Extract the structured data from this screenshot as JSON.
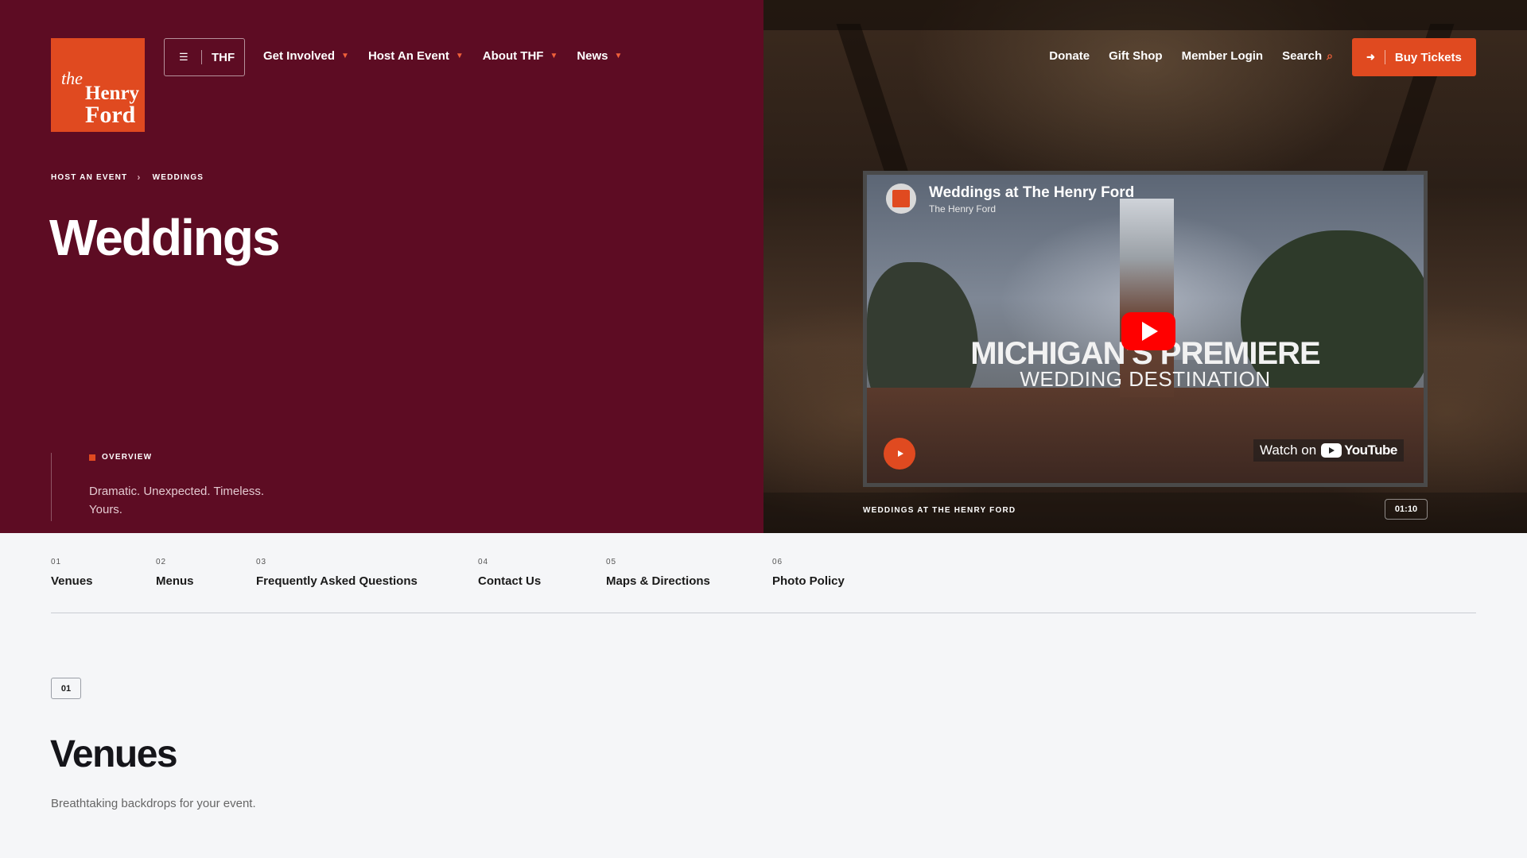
{
  "brand": {
    "logo_the": "the",
    "logo_henry": "Henry",
    "logo_ford": "Ford",
    "accent": "#e04a20",
    "hero_bg": "#5d0c23"
  },
  "header": {
    "menu_label": "THF",
    "nav": [
      {
        "label": "Get Involved"
      },
      {
        "label": "Host An Event"
      },
      {
        "label": "About THF"
      },
      {
        "label": "News"
      }
    ],
    "utility": {
      "donate": "Donate",
      "gift_shop": "Gift Shop",
      "member_login": "Member Login",
      "search": "Search"
    },
    "tickets_label": "Buy Tickets"
  },
  "breadcrumb": {
    "parent": "HOST AN EVENT",
    "current": "WEDDINGS"
  },
  "page_title": "Weddings",
  "overview": {
    "label": "OVERVIEW",
    "description": "Dramatic. Unexpected. Timeless. Yours."
  },
  "video": {
    "title": "Weddings at The Henry Ford",
    "channel": "The Henry Ford",
    "headline_1": "MICHIGAN'S PREMIERE",
    "headline_2": "WEDDING DESTINATION",
    "watch_on": "Watch on",
    "youtube": "YouTube",
    "caption": "WEDDINGS AT THE HENRY FORD",
    "duration": "01:10"
  },
  "section_nav": [
    {
      "num": "01",
      "label": "Venues"
    },
    {
      "num": "02",
      "label": "Menus"
    },
    {
      "num": "03",
      "label": "Frequently Asked Questions"
    },
    {
      "num": "04",
      "label": "Contact Us"
    },
    {
      "num": "05",
      "label": "Maps & Directions"
    },
    {
      "num": "06",
      "label": "Photo Policy"
    }
  ],
  "venues": {
    "badge": "01",
    "title": "Venues",
    "subtitle": "Breathtaking backdrops for your event."
  }
}
